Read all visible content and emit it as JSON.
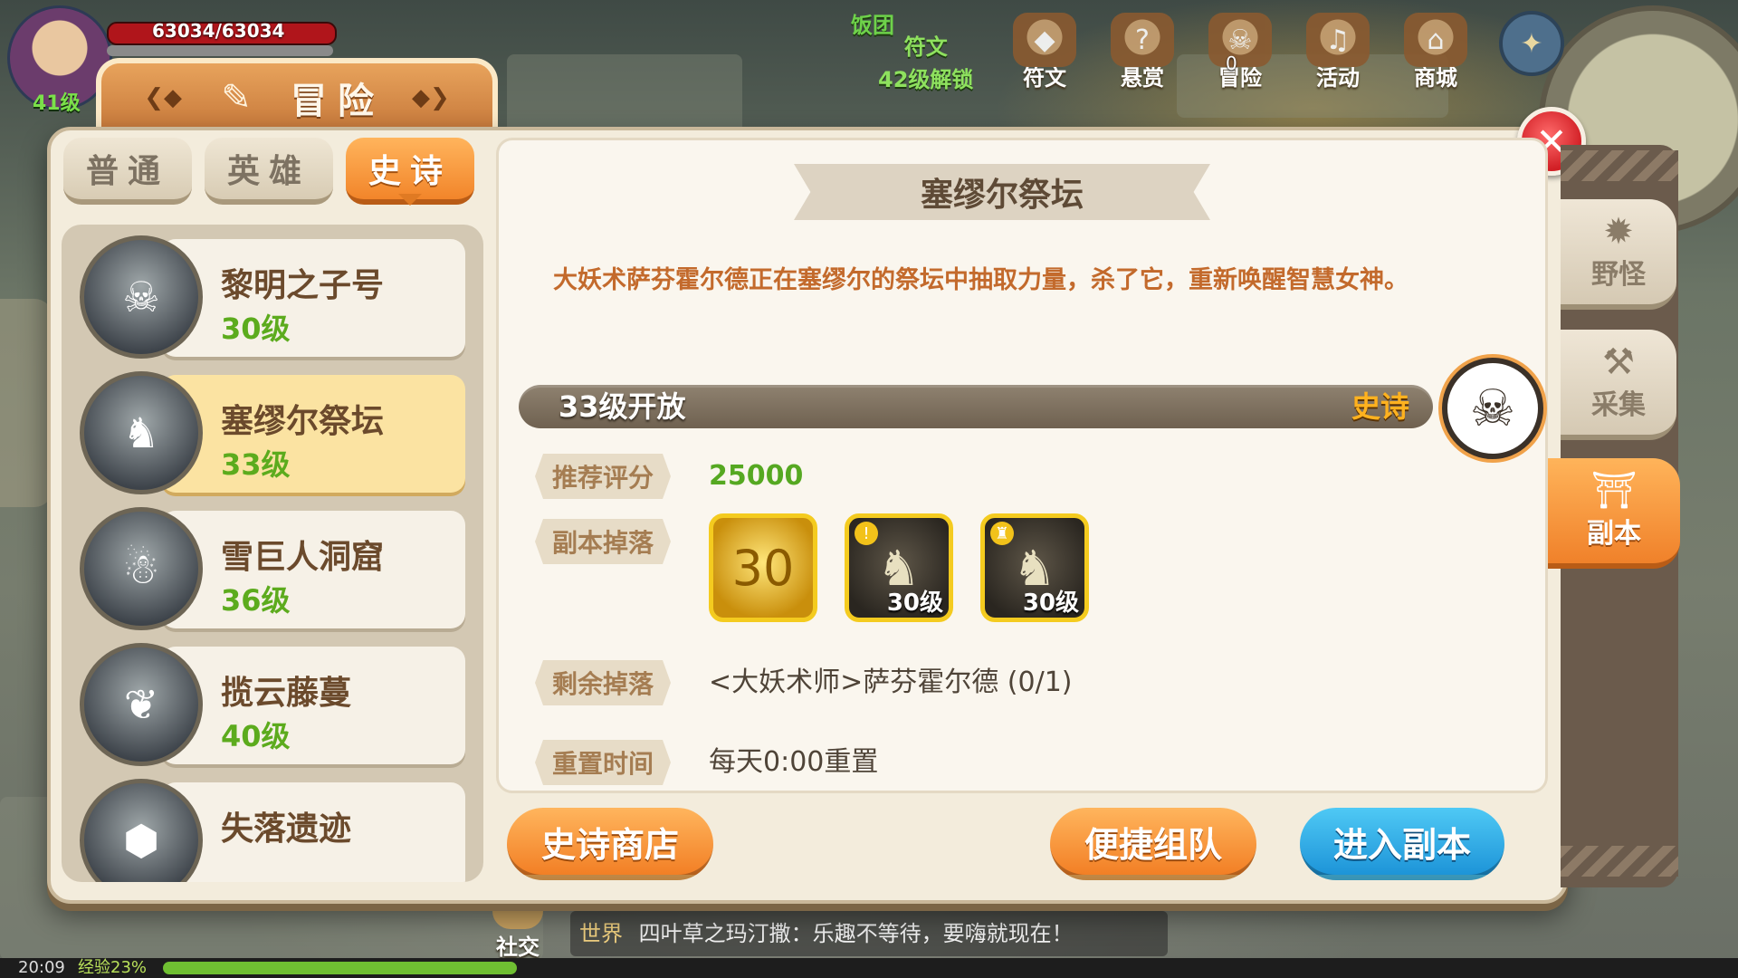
{
  "hud": {
    "hp_text": "63034/63034",
    "player_level": "41级",
    "notice": "饭团",
    "rune_tip_title": "符文",
    "rune_tip_lock": "42级解锁",
    "top_icons": [
      {
        "label": "符文",
        "icon": "rune-icon"
      },
      {
        "label": "悬赏",
        "icon": "bounty-icon"
      },
      {
        "label": "冒险",
        "icon": "adventure-icon"
      },
      {
        "label": "活动",
        "icon": "event-icon"
      },
      {
        "label": "商城",
        "icon": "shop-icon"
      }
    ],
    "adventure_badge": "0",
    "social_label": "社交",
    "chat_channel": "世界",
    "chat_message": "四叶草之玛汀撒：乐趣不等待，要嗨就现在！",
    "time": "20:09",
    "exp": "经验23%",
    "exp_percent": 23
  },
  "dialog": {
    "title": "冒险",
    "close_glyph": "✕",
    "difficulty_tabs": [
      {
        "label": "普通"
      },
      {
        "label": "英雄"
      },
      {
        "label": "史诗"
      }
    ],
    "active_difficulty": 2,
    "dungeons": [
      {
        "name": "黎明之子号",
        "level": "30级",
        "icon": "pirate-captain-icon"
      },
      {
        "name": "塞缪尔祭坛",
        "level": "33级",
        "icon": "shadow-dragon-icon"
      },
      {
        "name": "雪巨人洞窟",
        "level": "36级",
        "icon": "snow-giant-icon"
      },
      {
        "name": "揽云藤蔓",
        "level": "40级",
        "icon": "vine-monster-icon"
      },
      {
        "name": "失落遗迹",
        "level": "",
        "icon": "stone-ruin-icon"
      }
    ],
    "selected_dungeon": 1,
    "detail": {
      "title": "塞缪尔祭坛",
      "description": "大妖术萨芬霍尔德正在塞缪尔的祭坛中抽取力量，杀了它，重新唤醒智慧女神。",
      "open_level": "33级开放",
      "rank": "史诗",
      "rows": {
        "recommend_label": "推荐评分",
        "recommend_value": "25000",
        "drops_label": "副本掉落",
        "remaining_label": "剩余掉落",
        "remaining_value": "<大妖术师>萨芬霍尔德 (0/1)",
        "reset_label": "重置时间",
        "reset_value": "每天0:00重置"
      },
      "drops": [
        {
          "type": "coin",
          "text": "30",
          "level": ""
        },
        {
          "type": "equipment",
          "text": "",
          "level": "30级"
        },
        {
          "type": "equipment",
          "text": "",
          "level": "30级"
        }
      ]
    },
    "buttons": {
      "epic_shop": "史诗商店",
      "quick_team": "便捷组队",
      "enter_dungeon": "进入副本"
    },
    "side_tabs": [
      {
        "label": "野怪",
        "icon": "wild-monster-icon"
      },
      {
        "label": "采集",
        "icon": "gather-axe-icon"
      },
      {
        "label": "副本",
        "icon": "dungeon-gate-icon"
      }
    ],
    "active_side_tab": 2
  }
}
